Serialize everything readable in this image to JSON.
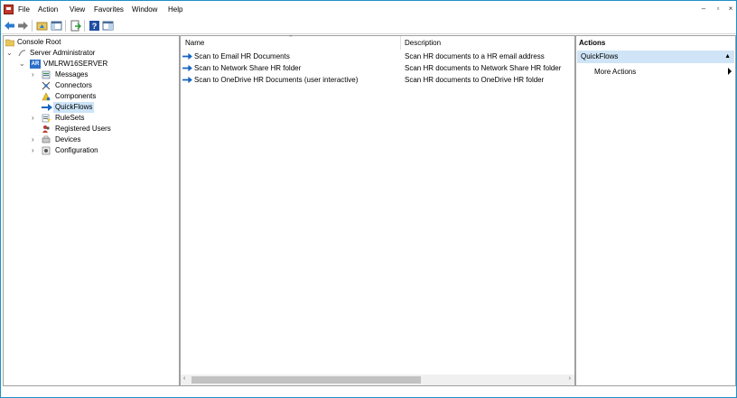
{
  "menubar": {
    "items": [
      "File",
      "Action",
      "View",
      "Favorites",
      "Window",
      "Help"
    ]
  },
  "tree": {
    "nodes": [
      {
        "label": "Console Root",
        "icon": "folder-icon"
      },
      {
        "label": "Server Administrator",
        "icon": "server-admin-icon"
      },
      {
        "label": "VMLRW16SERVER",
        "icon": "server-icon"
      },
      {
        "label": "Messages",
        "icon": "messages-icon"
      },
      {
        "label": "Connectors",
        "icon": "connectors-icon"
      },
      {
        "label": "Components",
        "icon": "components-icon"
      },
      {
        "label": "QuickFlows",
        "icon": "quickflows-arrow-icon"
      },
      {
        "label": "RuleSets",
        "icon": "rulesets-icon"
      },
      {
        "label": "Registered Users",
        "icon": "users-icon"
      },
      {
        "label": "Devices",
        "icon": "devices-icon"
      },
      {
        "label": "Configuration",
        "icon": "configuration-icon"
      }
    ],
    "server_badge": "AR"
  },
  "list": {
    "columns": {
      "name": "Name",
      "description": "Description"
    },
    "rows": [
      {
        "name": "Scan to Email HR Documents",
        "description": "Scan HR documents to a HR email address"
      },
      {
        "name": "Scan to Network Share HR folder",
        "description": "Scan HR documents to Network Share HR folder"
      },
      {
        "name": "Scan to OneDrive HR Documents (user interactive)",
        "description": "Scan HR documents to OneDrive HR folder"
      }
    ]
  },
  "actions": {
    "title": "Actions",
    "section": "QuickFlows",
    "items": [
      "More Actions"
    ]
  },
  "colors": {
    "accent": "#1e90c8",
    "selection": "#cce4f7",
    "arrow_blue": "#1565c0"
  }
}
